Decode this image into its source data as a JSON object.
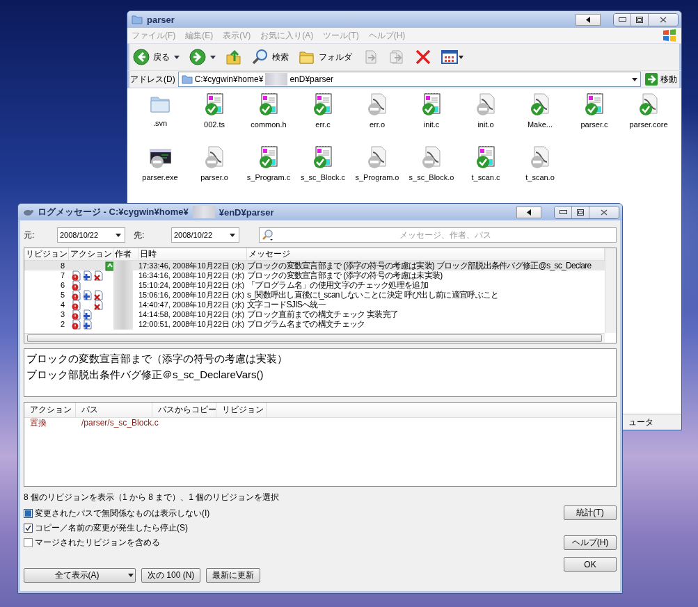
{
  "explorer": {
    "title": "parser",
    "menu": [
      "ファイル(F)",
      "編集(E)",
      "表示(V)",
      "お気に入り(A)",
      "ツール(T)",
      "ヘルプ(H)"
    ],
    "toolbar": [
      {
        "kind": "back",
        "label": "戻る"
      },
      {
        "kind": "forward"
      },
      {
        "kind": "up"
      },
      {
        "kind": "search",
        "label": "検索"
      },
      {
        "kind": "folders",
        "label": "フォルダ"
      },
      {
        "kind": "move"
      },
      {
        "kind": "copy"
      },
      {
        "kind": "delete"
      },
      {
        "kind": "views"
      }
    ],
    "address": {
      "label": "アドレス(D)",
      "path_start": "C:¥cygwin¥home¥",
      "path_end": "enD¥parser",
      "go": "移動"
    },
    "files": [
      {
        "name": ".svn",
        "kind": "folder"
      },
      {
        "name": "002.ts",
        "kind": "source"
      },
      {
        "name": "common.h",
        "kind": "source"
      },
      {
        "name": "err.c",
        "kind": "source"
      },
      {
        "name": "err.o",
        "kind": "object"
      },
      {
        "name": "init.c",
        "kind": "source"
      },
      {
        "name": "init.o",
        "kind": "object"
      },
      {
        "name": "Make...",
        "kind": "versioned"
      },
      {
        "name": "parser.c",
        "kind": "source"
      },
      {
        "name": "parser.core",
        "kind": "versioned"
      },
      {
        "name": "parser.exe",
        "kind": "program"
      },
      {
        "name": "parser.o",
        "kind": "object"
      },
      {
        "name": "s_Program.c",
        "kind": "source"
      },
      {
        "name": "s_sc_Block.c",
        "kind": "source"
      },
      {
        "name": "s_Program.o",
        "kind": "object"
      },
      {
        "name": "s_sc_Block.o",
        "kind": "object"
      },
      {
        "name": "t_scan.c",
        "kind": "source"
      },
      {
        "name": "t_scan.o",
        "kind": "object"
      }
    ],
    "status_bar": "ュータ"
  },
  "log_dialog": {
    "title_start": "ログメッセージ - C:¥cygwin¥home¥",
    "title_end": "¥enD¥parser",
    "from_label": "元:",
    "from_date": "2008/10/22",
    "to_label": "先:",
    "to_date": "2008/10/22",
    "search": {
      "placeholder": "メッセージ、作者、パス"
    },
    "columns": [
      "リビジョン",
      "アクション",
      "作者",
      "日時",
      "メッセージ"
    ],
    "rows": [
      {
        "revision": "8",
        "actions": {
          "modified": false,
          "added": false,
          "deleted": false,
          "replaced": true
        },
        "date": "17:33:46, 2008年10月22日 (水)",
        "message": "ブロックの変数宣言部まで (添字の符号の考慮は実装) ブロック部脱出条件バグ修正@s_sc_Declare",
        "selected": true
      },
      {
        "revision": "7",
        "actions": {
          "modified": true,
          "added": true,
          "deleted": true,
          "replaced": false
        },
        "date": "16:34:16, 2008年10月22日 (水)",
        "message": "ブロックの変数宣言部まで (添字の符号の考慮は未実装)",
        "selected": false
      },
      {
        "revision": "6",
        "actions": {
          "modified": true,
          "added": false,
          "deleted": false,
          "replaced": false
        },
        "date": "15:10:24, 2008年10月22日 (水)",
        "message": "「プログラム名」の使用文字のチェック処理を追加",
        "selected": false
      },
      {
        "revision": "5",
        "actions": {
          "modified": true,
          "added": true,
          "deleted": true,
          "replaced": false
        },
        "date": "15:06:16, 2008年10月22日 (水)",
        "message": "s_関数呼出し直後にt_scanしないことに決定 呼び出し前に適宜呼ぶこと",
        "selected": false
      },
      {
        "revision": "4",
        "actions": {
          "modified": true,
          "added": false,
          "deleted": true,
          "replaced": false
        },
        "date": "14:40:47, 2008年10月22日 (水)",
        "message": "文字コードSJISへ統一",
        "selected": false
      },
      {
        "revision": "3",
        "actions": {
          "modified": true,
          "added": true,
          "deleted": false,
          "replaced": false
        },
        "date": "14:14:58, 2008年10月22日 (水)",
        "message": "ブロック直前までの構文チェック 実装完了",
        "selected": false
      },
      {
        "revision": "2",
        "actions": {
          "modified": true,
          "added": true,
          "deleted": false,
          "replaced": false
        },
        "date": "12:00:51, 2008年10月22日 (水)",
        "message": "プログラム名までの構文チェック",
        "selected": false
      }
    ],
    "detail": [
      "ブロックの変数宣言部まで（添字の符号の考慮は実装）",
      "ブロック部脱出条件バグ修正＠s_sc_DeclareVars()"
    ],
    "path_columns": [
      "アクション",
      "パス",
      "パスからコピー",
      "リビジョン"
    ],
    "paths": [
      {
        "action": "置換",
        "path": "/parser/s_sc_Block.c"
      }
    ],
    "status": "8 個のリビジョンを表示（1 から 8 まで）、1 個のリビジョンを選択",
    "options": [
      {
        "label": "変更されたパスで無関係なものは表示しない(I)",
        "checked": true,
        "partial": true
      },
      {
        "label": "コピー／名前の変更が発生したら停止(S)",
        "checked": true,
        "partial": false
      },
      {
        "label": "マージされたリビジョンを含める",
        "checked": false,
        "partial": false
      }
    ],
    "buttons": [
      {
        "label": "全て表示(A)",
        "kind": "split"
      },
      {
        "label": "次の 100 (N)",
        "kind": "push"
      },
      {
        "label": "最新に更新",
        "kind": "push"
      }
    ],
    "side_buttons": [
      "統計(T)",
      "ヘルプ(H)",
      "OK"
    ]
  }
}
